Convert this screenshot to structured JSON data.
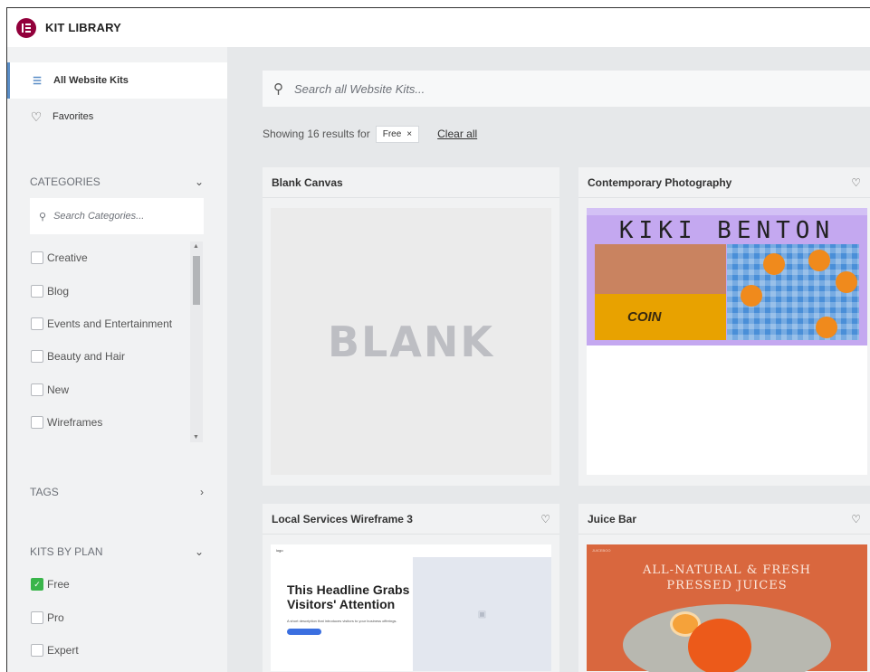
{
  "header": {
    "title": "KIT LIBRARY"
  },
  "sidebar": {
    "nav": [
      {
        "label": "All Website Kits",
        "icon": "filter-lines-icon",
        "active": true
      },
      {
        "label": "Favorites",
        "icon": "heart-icon",
        "active": false
      }
    ],
    "categories": {
      "title": "CATEGORIES",
      "search_placeholder": "Search Categories...",
      "items": [
        "Creative",
        "Blog",
        "Events and Entertainment",
        "Beauty and Hair",
        "New",
        "Wireframes"
      ]
    },
    "tags": {
      "title": "TAGS"
    },
    "plans": {
      "title": "KITS BY PLAN",
      "items": [
        {
          "label": "Free",
          "checked": true
        },
        {
          "label": "Pro",
          "checked": false
        },
        {
          "label": "Expert",
          "checked": false
        }
      ]
    }
  },
  "main": {
    "search_placeholder": "Search all Website Kits...",
    "results": {
      "text": "Showing 16 results for",
      "chip": "Free",
      "clear": "Clear all"
    },
    "cards": [
      {
        "title": "Blank Canvas",
        "thumb_text": "BLANK"
      },
      {
        "title": "Contemporary Photography",
        "thumb_title": "KIKI BENTON",
        "thumb_word": "COIN"
      },
      {
        "title": "Local Services Wireframe 3",
        "thumb_brand": "logo",
        "thumb_headline": "This Headline Grabs Visitors' Attention",
        "thumb_desc": "A short description that introduces visitors to your business offerings."
      },
      {
        "title": "Juice Bar",
        "thumb_brand": "JUICEBOO",
        "thumb_title_1": "ALL-NATURAL & FRESH",
        "thumb_title_2": "PRESSED JUICES"
      }
    ]
  },
  "colors": {
    "brand": "#92003b",
    "accent": "#5b8ec7",
    "checked": "#39b54a"
  }
}
